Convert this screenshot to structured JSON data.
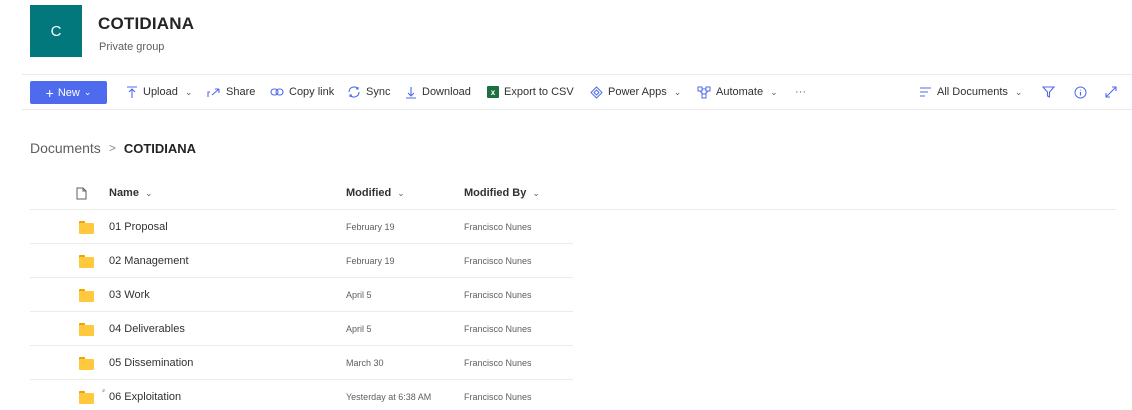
{
  "group": {
    "logo_letter": "C",
    "title": "COTIDIANA",
    "subtitle": "Private group"
  },
  "toolbar": {
    "new_label": "New",
    "upload_label": "Upload",
    "share_label": "Share",
    "copy_link_label": "Copy link",
    "sync_label": "Sync",
    "download_label": "Download",
    "export_csv_label": "Export to CSV",
    "power_apps_label": "Power Apps",
    "automate_label": "Automate",
    "more_label": "···",
    "view_label": "All Documents"
  },
  "breadcrumb": {
    "root": "Documents",
    "current": "COTIDIANA"
  },
  "table": {
    "columns": {
      "name": "Name",
      "modified": "Modified",
      "modified_by": "Modified By"
    },
    "rows": [
      {
        "name": "01 Proposal",
        "modified": "February 19",
        "modified_by": "Francisco Nunes"
      },
      {
        "name": "02 Management",
        "modified": "February 19",
        "modified_by": "Francisco Nunes"
      },
      {
        "name": "03 Work",
        "modified": "April 5",
        "modified_by": "Francisco Nunes"
      },
      {
        "name": "04 Deliverables",
        "modified": "April 5",
        "modified_by": "Francisco Nunes"
      },
      {
        "name": "05 Dissemination",
        "modified": "March 30",
        "modified_by": "Francisco Nunes"
      },
      {
        "name": "06 Exploitation",
        "modified": "Yesterday at 6:38 AM",
        "modified_by": "Francisco Nunes",
        "new_marker": "⸗"
      }
    ]
  },
  "colors": {
    "accent": "#4f6bed",
    "group_logo": "#03787c",
    "folder": "#ffc83d",
    "excel": "#1d6f42"
  }
}
